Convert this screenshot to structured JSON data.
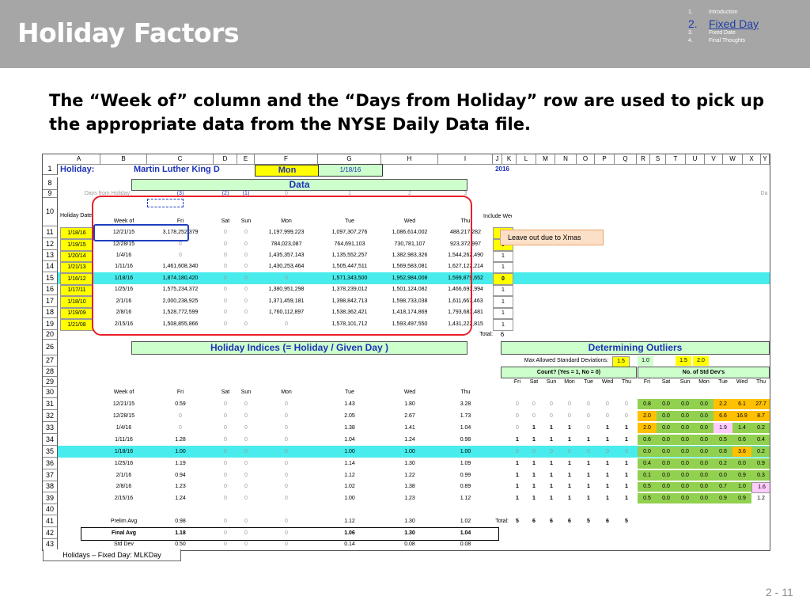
{
  "slide_title": "Holiday Factors",
  "agenda": [
    {
      "num": "1.",
      "label": "Introduction"
    },
    {
      "num": "2.",
      "label": "Fixed Day"
    },
    {
      "num": "3.",
      "label": "Fixed Date"
    },
    {
      "num": "4.",
      "label": "Final Thoughts"
    }
  ],
  "subtitle": "The “Week of” column and the “Days from Holiday” row are used to pick up the appropriate data from the NYSE Daily Data file.",
  "sheet_tab": "Holidays – Fixed Day:  MLKDay",
  "page_number": "2 -  11",
  "note_text": "Leave out due to Xmas",
  "columns": [
    "A",
    "B",
    "C",
    "D",
    "E",
    "F",
    "G",
    "H",
    "I",
    "J",
    "K",
    "L",
    "M",
    "N",
    "O",
    "P",
    "Q",
    "R",
    "S",
    "T",
    "U",
    "V",
    "W",
    "X",
    "Y"
  ],
  "rows": {
    "r1": {
      "hdr": "1",
      "holiday_label": "Holiday:",
      "holiday_name": "Martin Luther King D",
      "day": "Mon",
      "date": "1/18/16",
      "year": "2016"
    },
    "r8": {
      "hdr": "8",
      "data_label": "Data"
    },
    "r9": {
      "hdr": "9",
      "days_from": "Days from Holiday:",
      "vals": [
        "(3)",
        "(2)",
        "(1)",
        "0",
        "1",
        "2",
        "3"
      ],
      "trail": "Da"
    },
    "r10": {
      "hdr": "10",
      "cols": [
        "Holiday Date",
        "Week of",
        "Fri",
        "Sat",
        "Sun",
        "Mon",
        "Tue",
        "Wed",
        "Thu",
        "Include Week?"
      ]
    },
    "total": {
      "hdr": "20",
      "label": "Total:",
      "value": "6"
    }
  },
  "data_rows": [
    {
      "hdr": "11",
      "date": "1/18/16",
      "week": "12/21/15",
      "vals": [
        "3,178,252,379",
        "0",
        "0",
        "1,197,999,223",
        "1,097,307,276",
        "1,086,614,002",
        "488,217,282"
      ],
      "include": "0"
    },
    {
      "hdr": "12",
      "date": "1/19/15",
      "week": "12/28/15",
      "vals": [
        "0",
        "0",
        "0",
        "784,023,087",
        "764,691,103",
        "730,781,107",
        "923,372,997"
      ],
      "include": "0"
    },
    {
      "hdr": "13",
      "date": "1/20/14",
      "week": "1/4/16",
      "vals": [
        "0",
        "0",
        "0",
        "1,435,357,143",
        "1,135,552,257",
        "1,382,983,326",
        "1,544,262,490"
      ],
      "include": "1"
    },
    {
      "hdr": "14",
      "date": "1/21/13",
      "week": "1/11/16",
      "vals": [
        "1,461,608,340",
        "0",
        "0",
        "1,430,253,464",
        "1,505,447,511",
        "1,569,583,081",
        "1,627,122,214"
      ],
      "include": "1"
    },
    {
      "hdr": "15",
      "date": "1/16/12",
      "week": "1/18/16",
      "vals": [
        "1,874,180,420",
        "0",
        "0",
        "0",
        "1,571,343,500",
        "1,952,984,008",
        "1,599,879,652"
      ],
      "include": "0"
    },
    {
      "hdr": "16",
      "date": "1/17/11",
      "week": "1/25/16",
      "vals": [
        "1,575,234,372",
        "0",
        "0",
        "1,380,951,298",
        "1,378,239,012",
        "1,501,124,082",
        "1,466,693,994"
      ],
      "include": "1"
    },
    {
      "hdr": "17",
      "date": "1/18/10",
      "week": "2/1/16",
      "vals": [
        "2,000,238,925",
        "0",
        "0",
        "1,371,459,181",
        "1,398,842,713",
        "1,598,733,038",
        "1,611,667,463"
      ],
      "include": "1"
    },
    {
      "hdr": "18",
      "date": "1/19/09",
      "week": "2/8/16",
      "vals": [
        "1,528,772,599",
        "0",
        "0",
        "1,760,112,897",
        "1,538,362,421",
        "1,418,174,869",
        "1,793,683,481"
      ],
      "include": "1"
    },
    {
      "hdr": "19",
      "date": "1/21/08",
      "week": "2/15/16",
      "vals": [
        "1,508,855,866",
        "0",
        "0",
        "0",
        "1,578,101,712",
        "1,593,497,550",
        "1,431,222,815"
      ],
      "include": "1"
    }
  ],
  "lower": {
    "indices_title": "Holiday Indices  (= Holiday / Given Day )",
    "outliers_title": "Determining Outliers",
    "max_allowed_label": "Max Allowed Standard Deviations:",
    "max_allowed_vals": [
      "1.5",
      "1.0",
      "1.5",
      "2.0"
    ],
    "count_label": "Count?  (Yes = 1, No = 0)",
    "std_label": "No. of Std Dev's",
    "day_hdrs": [
      "Fri",
      "Sat",
      "Sun",
      "Mon",
      "Tue",
      "Wed",
      "Thu"
    ],
    "left_hdrs": [
      "Week of",
      "Fri",
      "Sat",
      "Sun",
      "Mon",
      "Tue",
      "Wed",
      "Thu"
    ],
    "row_headers": [
      "26",
      "27",
      "28",
      "29",
      "30"
    ],
    "idx_rows": [
      {
        "hdr": "31",
        "week": "12/21/15",
        "vals": [
          "0.59",
          "0",
          "0",
          "0",
          "1.43",
          "1.80",
          "3.28"
        ],
        "count": [
          "0",
          "0",
          "0",
          "0",
          "0",
          "0",
          "0"
        ],
        "std": [
          "0.8",
          "0.0",
          "0.0",
          "0.0",
          "2.2",
          "6.1",
          "27.7"
        ]
      },
      {
        "hdr": "32",
        "week": "12/28/15",
        "vals": [
          "0",
          "0",
          "0",
          "0",
          "2.05",
          "2.67",
          "1.73"
        ],
        "count": [
          "0",
          "0",
          "0",
          "0",
          "0",
          "0",
          "0"
        ],
        "std": [
          "2.0",
          "0.0",
          "0.0",
          "0.0",
          "6.6",
          "16.9",
          "8.7"
        ]
      },
      {
        "hdr": "33",
        "week": "1/4/16",
        "vals": [
          "0",
          "0",
          "0",
          "0",
          "1.38",
          "1.41",
          "1.04"
        ],
        "count": [
          "0",
          "1",
          "1",
          "1",
          "0",
          "1",
          "1"
        ],
        "std": [
          "2.0",
          "0.0",
          "0.0",
          "0.0",
          "1.9",
          "1.4",
          "0.2"
        ]
      },
      {
        "hdr": "34",
        "week": "1/11/16",
        "vals": [
          "1.28",
          "0",
          "0",
          "0",
          "1.04",
          "1.24",
          "0.98"
        ],
        "count": [
          "1",
          "1",
          "1",
          "1",
          "1",
          "1",
          "1"
        ],
        "std": [
          "0.6",
          "0.0",
          "0.0",
          "0.0",
          "0.5",
          "0.6",
          "0.4"
        ]
      },
      {
        "hdr": "35",
        "week": "1/18/16",
        "vals": [
          "1.00",
          "0",
          "0",
          "0",
          "1.00",
          "1.00",
          "1.00"
        ],
        "count": [
          "0",
          "0",
          "0",
          "0",
          "0",
          "0",
          "0"
        ],
        "std": [
          "0.0",
          "0.0",
          "0.0",
          "0.0",
          "0.8",
          "3.6",
          "0.2"
        ]
      },
      {
        "hdr": "36",
        "week": "1/25/16",
        "vals": [
          "1.19",
          "0",
          "0",
          "0",
          "1.14",
          "1.30",
          "1.09"
        ],
        "count": [
          "1",
          "1",
          "1",
          "1",
          "1",
          "1",
          "1"
        ],
        "std": [
          "0.4",
          "0.0",
          "0.0",
          "0.0",
          "0.2",
          "0.0",
          "0.9"
        ]
      },
      {
        "hdr": "37",
        "week": "2/1/16",
        "vals": [
          "0.94",
          "0",
          "0",
          "0",
          "1.12",
          "1.22",
          "0.99"
        ],
        "count": [
          "1",
          "1",
          "1",
          "1",
          "1",
          "1",
          "1"
        ],
        "std": [
          "0.1",
          "0.0",
          "0.0",
          "0.0",
          "0.0",
          "0.9",
          "0.3"
        ]
      },
      {
        "hdr": "38",
        "week": "2/8/16",
        "vals": [
          "1.23",
          "0",
          "0",
          "0",
          "1.02",
          "1.38",
          "0.89"
        ],
        "count": [
          "1",
          "1",
          "1",
          "1",
          "1",
          "1",
          "1"
        ],
        "std": [
          "0.5",
          "0.0",
          "0.0",
          "0.0",
          "0.7",
          "1.0",
          "1.6"
        ]
      },
      {
        "hdr": "39",
        "week": "2/15/16",
        "vals": [
          "1.24",
          "0",
          "0",
          "0",
          "1.00",
          "1.23",
          "1.12"
        ],
        "count": [
          "1",
          "1",
          "1",
          "1",
          "1",
          "1",
          "1"
        ],
        "std": [
          "0.5",
          "0.0",
          "0.0",
          "0.0",
          "0.9",
          "0.9",
          "1.2"
        ]
      }
    ],
    "row40": {
      "hdr": "40"
    },
    "summary": [
      {
        "hdr": "41",
        "label": "Prelim Avg",
        "vals": [
          "0.98",
          "0",
          "0",
          "0",
          "1.12",
          "1.30",
          "1.02"
        ],
        "total_label": "Total:",
        "totals": [
          "5",
          "6",
          "6",
          "6",
          "5",
          "6",
          "5"
        ]
      },
      {
        "hdr": "42",
        "label": "Final Avg",
        "vals": [
          "1.18",
          "0",
          "0",
          "0",
          "1.06",
          "1.30",
          "1.04"
        ]
      },
      {
        "hdr": "43",
        "label": "Std Dev",
        "vals": [
          "0.50",
          "0",
          "0",
          "0",
          "0.14",
          "0.08",
          "0.08"
        ]
      }
    ]
  },
  "colors": {
    "header_bg": "#a6a6a6",
    "highlight_cyan": "#48ecec",
    "yellow": "#ffff00",
    "green_bar": "#ccffcc",
    "red_outline": "#e8202a",
    "blue_outline": "#1e3ebf",
    "std_green": "#92d050",
    "std_orange": "#ffc000",
    "std_pink": "#ffccff"
  }
}
